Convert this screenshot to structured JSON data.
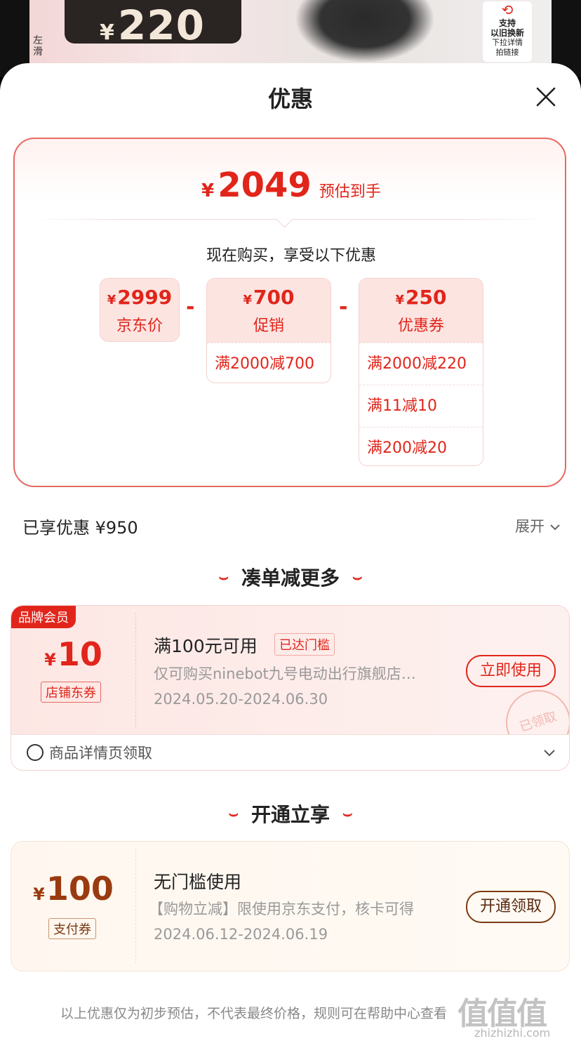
{
  "background": {
    "price_currency": "¥",
    "price": "220",
    "left_tag": "左滑",
    "badge": [
      "支持",
      "以旧换新",
      "下拉详情",
      "拍链接"
    ]
  },
  "sheet": {
    "title": "优惠",
    "close_icon": "close-icon"
  },
  "summary": {
    "currency": "¥",
    "final_price": "2049",
    "final_label": "预估到手",
    "subtitle": "现在购买，享受以下优惠",
    "jd_price": {
      "currency": "¥",
      "value": "2999",
      "label": "京东价"
    },
    "promo": {
      "currency": "¥",
      "value": "700",
      "label": "促销",
      "rows": [
        "满2000减700"
      ]
    },
    "coupon": {
      "currency": "¥",
      "value": "250",
      "label": "优惠券",
      "rows": [
        "满2000减220",
        "满11减10",
        "满200减20"
      ]
    },
    "minus": "-"
  },
  "enjoyed": {
    "label": "已享优惠 ¥950",
    "expand": "展开"
  },
  "section_more": {
    "title": "凑单减更多"
  },
  "coupon_store": {
    "member_tag": "品牌会员",
    "currency": "¥",
    "value": "10",
    "type": "店铺东券",
    "title": "满100元可用",
    "reach_tag": "已达门槛",
    "desc": "仅可购买ninebot九号电动出行旗舰店…",
    "date": "2024.05.20-2024.06.30",
    "button": "立即使用",
    "stamp": "已领取",
    "source": "商品详情页领取"
  },
  "section_open": {
    "title": "开通立享"
  },
  "coupon_pay": {
    "currency": "¥",
    "value": "100",
    "type": "支付券",
    "title": "无门槛使用",
    "desc": "【购物立减】限使用京东支付，核卡可得",
    "date": "2024.06.12-2024.06.19",
    "button": "开通领取"
  },
  "footer": "以上优惠仅为初步预估，不代表最终价格，规则可在帮助中心查看",
  "watermark": {
    "logo": "值值值",
    "site": "zhizhizhi.com"
  },
  "colors": {
    "accent": "#e1251b",
    "pay_brown": "#7b3a12"
  }
}
